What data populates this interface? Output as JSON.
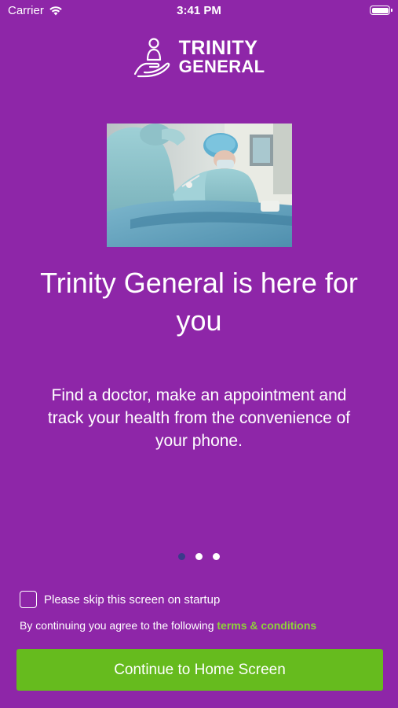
{
  "status_bar": {
    "carrier": "Carrier",
    "time": "3:41 PM"
  },
  "logo": {
    "line1": "TRINITY",
    "line2": "GENERAL",
    "icon": "caring-hand-person-icon"
  },
  "hero_image": {
    "icon": "surgeons-photo"
  },
  "headline": "Trinity General is here for you",
  "subtext": "Find a doctor, make an appointment and track your health from the convenience of your phone.",
  "pagination": {
    "total": 3,
    "active_index": 0
  },
  "skip_option": {
    "label": "Please skip this screen on startup",
    "checked": false
  },
  "terms": {
    "prefix": "By continuing you agree to the following",
    "link": "terms & conditions"
  },
  "continue_button": {
    "label": "Continue to Home Screen"
  },
  "colors": {
    "background": "#8e26a8",
    "button": "#66bb1e",
    "link": "#8fd13a",
    "active_dot": "#3a3a8a"
  }
}
